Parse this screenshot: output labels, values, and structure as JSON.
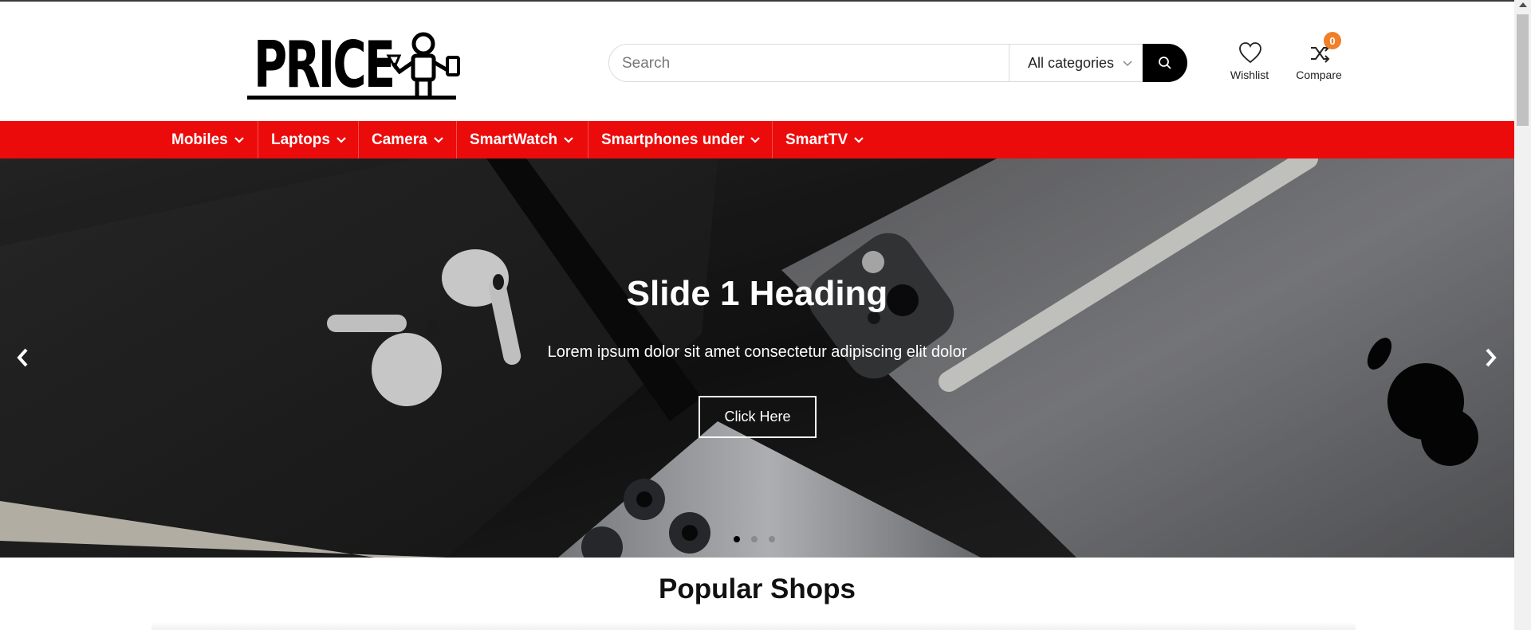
{
  "header": {
    "logo_text": "PRICE",
    "search": {
      "placeholder": "Search",
      "category": "All categories"
    },
    "wishlist_label": "Wishlist",
    "compare_label": "Compare",
    "compare_count": "0"
  },
  "nav": {
    "items": [
      {
        "label": "Mobiles"
      },
      {
        "label": "Laptops"
      },
      {
        "label": "Camera"
      },
      {
        "label": "SmartWatch"
      },
      {
        "label": "Smartphones under"
      },
      {
        "label": "SmartTV"
      }
    ]
  },
  "hero": {
    "heading": "Slide 1 Heading",
    "subheading": "Lorem ipsum dolor sit amet consectetur adipiscing elit dolor",
    "button_label": "Click Here",
    "slide_count": 3,
    "active_slide": 1
  },
  "sections": {
    "popular_shops_title": "Popular Shops"
  },
  "colors": {
    "nav_bg": "#ec0b0b",
    "badge": "#f07f2a",
    "search_button": "#000000"
  },
  "icons": {
    "search": "search-icon",
    "wishlist": "heart-icon",
    "compare": "shuffle-icon",
    "prev": "chevron-left-icon",
    "next": "chevron-right-icon"
  }
}
